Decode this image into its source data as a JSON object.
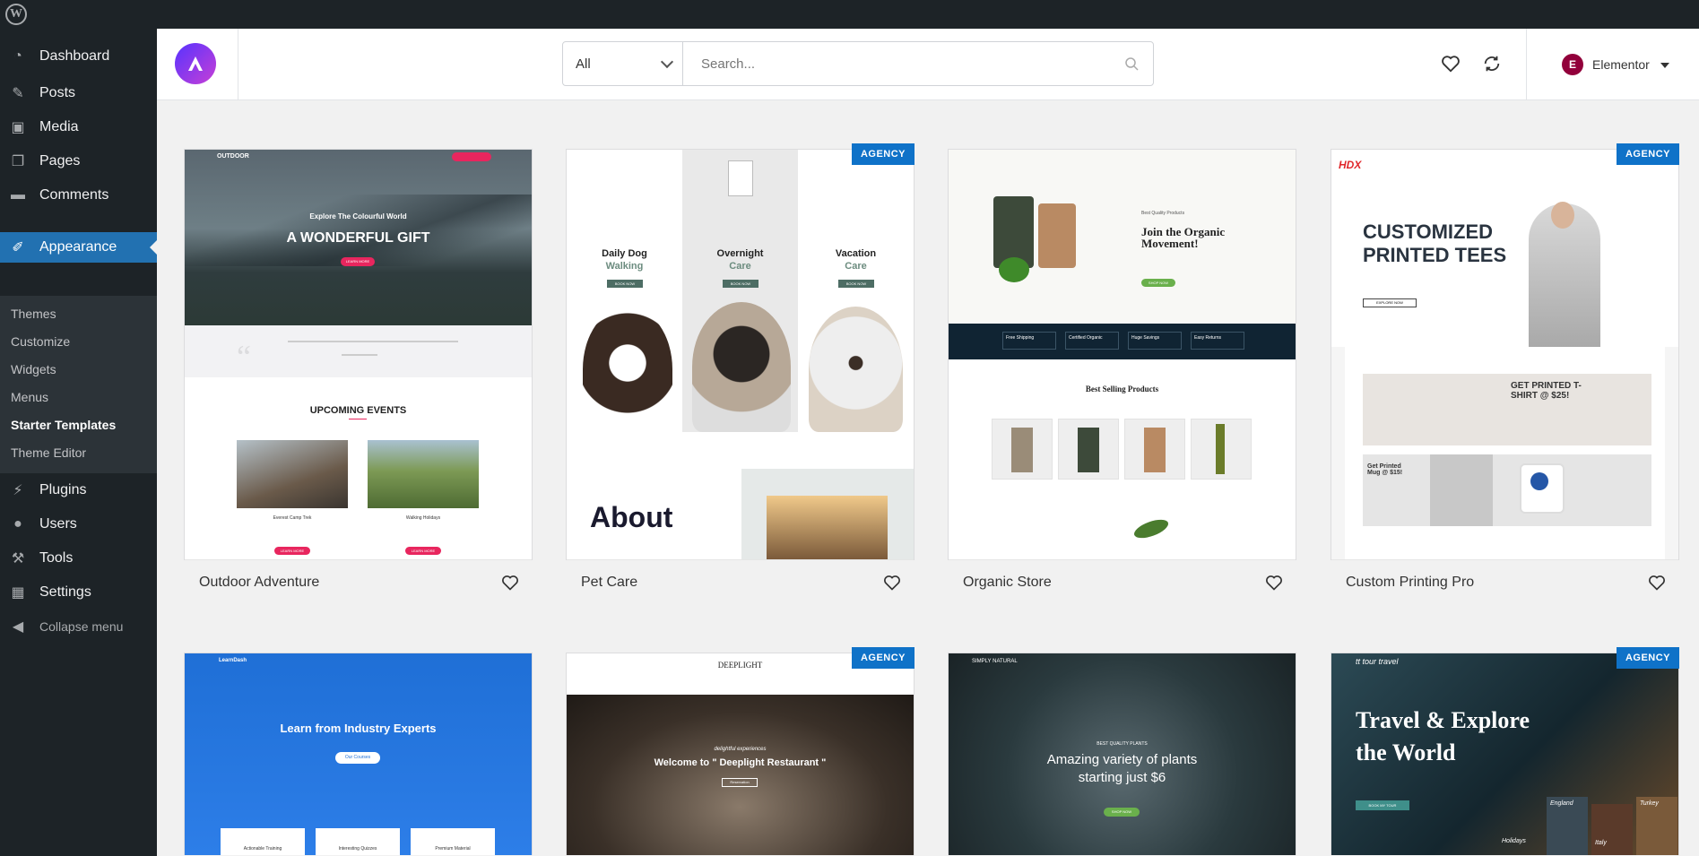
{
  "admin_bar": {
    "logo": "W"
  },
  "sidebar": {
    "items": [
      {
        "label": "Dashboard",
        "icon": "dashboard-icon"
      },
      {
        "label": "Posts",
        "icon": "pin-icon"
      },
      {
        "label": "Media",
        "icon": "media-icon"
      },
      {
        "label": "Pages",
        "icon": "pages-icon"
      },
      {
        "label": "Comments",
        "icon": "comment-icon"
      },
      {
        "label": "Appearance",
        "icon": "brush-icon"
      },
      {
        "label": "Plugins",
        "icon": "plug-icon"
      },
      {
        "label": "Users",
        "icon": "user-icon"
      },
      {
        "label": "Tools",
        "icon": "wrench-icon"
      },
      {
        "label": "Settings",
        "icon": "settings-icon"
      },
      {
        "label": "Collapse menu",
        "icon": "collapse-icon"
      }
    ],
    "submenu": [
      "Themes",
      "Customize",
      "Widgets",
      "Menus",
      "Starter Templates",
      "Theme Editor"
    ]
  },
  "header": {
    "category": "All",
    "search_placeholder": "Search...",
    "builder": "Elementor",
    "builder_logo": "E"
  },
  "colors": {
    "accent": "#2271b1",
    "badge": "#0f72c8",
    "sidebar": "#1d2327"
  },
  "templates": [
    {
      "name": "Outdoor Adventure",
      "badge": "",
      "nav": "OUTDOOR",
      "tagline": "Explore The Colourful World",
      "hero": "A WONDERFUL GIFT",
      "cta": "LEARN MORE",
      "section": "UPCOMING EVENTS",
      "event1": "Everest Camp Trek",
      "event2": "Walking Holidays",
      "btn": "LEARN MORE"
    },
    {
      "name": "Pet Care",
      "badge": "AGENCY",
      "col1a": "Daily Dog",
      "col1b": "Walking",
      "col2a": "Overnight",
      "col2b": "Care",
      "col3a": "Vacation",
      "col3b": "Care",
      "btn": "BOOK NOW",
      "about": "About"
    },
    {
      "name": "Organic Store",
      "badge": "",
      "kicker": "Best Quality Products",
      "hero": "Join the Organic Movement!",
      "cta": "SHOP NOW",
      "f1": "Free Shipping",
      "f2": "Certified Organic",
      "f3": "Huge Savings",
      "f4": "Easy Returns",
      "section": "Best Selling Products"
    },
    {
      "name": "Custom Printing Pro",
      "badge": "AGENCY",
      "logo": "HDX",
      "hero1": "CUSTOMIZED",
      "hero2": "PRINTED TEES",
      "cta": "EXPLORE NOW",
      "promo": "GET PRINTED T-SHIRT @ $25!",
      "mug": "Get Printed Mug @ $15!",
      "shop": "VISIT STORE"
    },
    {
      "name": "",
      "badge": "",
      "logo": "LearnDash",
      "hero": "Learn from Industry Experts",
      "cta": "Our Courses",
      "c1": "Actionable Training",
      "c2": "Interesting Quizzes",
      "c3": "Premium Material"
    },
    {
      "name": "",
      "badge": "AGENCY",
      "logo": "DEEPLIGHT",
      "kicker": "delightful experiences",
      "hero": "Welcome to \" Deeplight Restaurant \"",
      "cta": "Reservation"
    },
    {
      "name": "",
      "badge": "",
      "logo": "SIMPLY NATURAL",
      "kicker": "BEST QUALITY PLANTS",
      "hero1": "Amazing variety of plants",
      "hero2": "starting just $6",
      "cta": "SHOP NOW"
    },
    {
      "name": "",
      "badge": "AGENCY",
      "logo": "tt tour travel",
      "hero1": "Travel & Explore",
      "hero2": "the World",
      "cta": "BOOK MY TOUR",
      "d1": "England",
      "d2": "Holidays",
      "d3": "Italy",
      "d4": "Turkey"
    }
  ]
}
